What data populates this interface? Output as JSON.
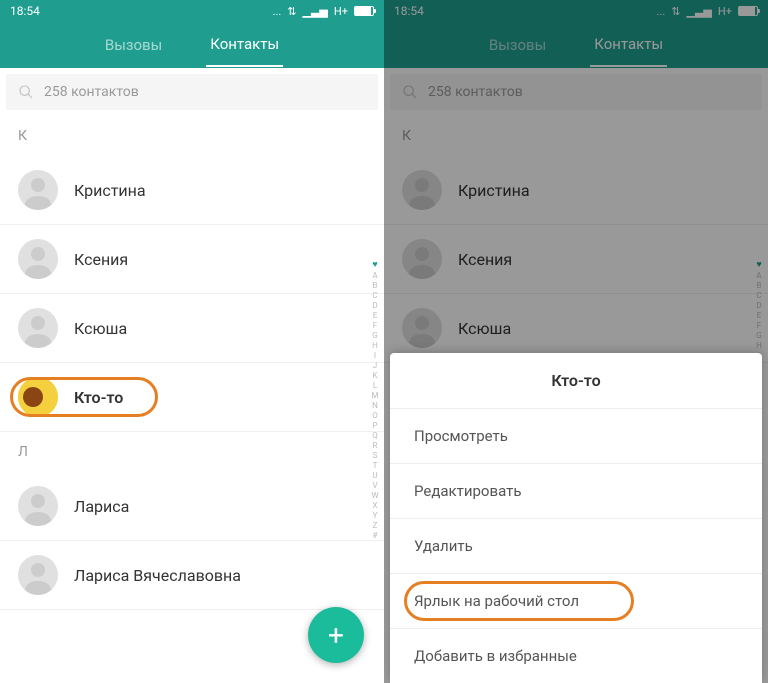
{
  "status": {
    "time": "18:54",
    "network": "H+",
    "dots": "..."
  },
  "header": {
    "tab_calls": "Вызовы",
    "tab_contacts": "Контакты"
  },
  "search": {
    "placeholder": "258 контактов"
  },
  "sections": {
    "k": "К",
    "l": "Л"
  },
  "contacts": {
    "0": "Кристина",
    "1": "Ксения",
    "2": "Ксюша",
    "3": "Кто-то",
    "4": "Лариса",
    "5": "Лариса Вячеславовна"
  },
  "alpha_index": [
    "A",
    "B",
    "C",
    "D",
    "E",
    "F",
    "G",
    "H",
    "I",
    "J",
    "K",
    "L",
    "M",
    "N",
    "O",
    "P",
    "Q",
    "R",
    "S",
    "T",
    "U",
    "V",
    "W",
    "X",
    "Y",
    "Z",
    "#"
  ],
  "sheet": {
    "title": "Кто-то",
    "items": {
      "0": "Просмотреть",
      "1": "Редактировать",
      "2": "Удалить",
      "3": "Ярлык на рабочий стол",
      "4": "Добавить в избранные"
    }
  },
  "colors": {
    "primary": "#1f9e8f",
    "accent": "#1abc9c",
    "highlight": "#e67e22"
  }
}
